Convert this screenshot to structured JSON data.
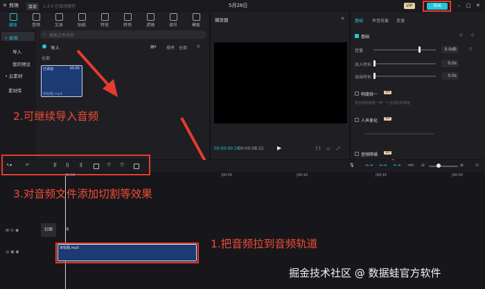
{
  "titlebar": {
    "app_name": "剪映",
    "menu": "菜单",
    "version_hint": "1.3.0  已自动保存",
    "project_date": "5月28日",
    "vip_badge": "VIP",
    "export_label": "导出"
  },
  "toolbar": {
    "tabs": [
      "媒体",
      "音频",
      "文本",
      "贴纸",
      "特效",
      "转场",
      "滤镜",
      "调节",
      "模板"
    ]
  },
  "sidebar": {
    "items": [
      "• 本地",
      "导入",
      "我的预设",
      "• 云素材",
      "素材库"
    ]
  },
  "media": {
    "search_placeholder": "搜索文件名称",
    "import_label": "导入",
    "sort_label": "排序",
    "all_label": "全部",
    "section_label": "全部",
    "clip_added": "已添加",
    "clip_duration": "00:05",
    "clip_name": "未标题.mp3"
  },
  "player": {
    "title": "播放器",
    "current_time": "00:00:00:16",
    "total_time": "00:00:08:22"
  },
  "inspector": {
    "tabs": [
      "基础",
      "声音效果",
      "变速"
    ],
    "section_basic": "基础",
    "volume_label": "音量",
    "volume_value": "0.0dB",
    "fade_in_label": "淡入时长",
    "fade_in_value": "0.0s",
    "fade_out_label": "淡出时长",
    "fade_out_value": "0.0s",
    "loudness_label": "响度统一",
    "loudness_desc": "将音频响度统一到一个合适的标准值",
    "voice_label": "人声美化",
    "denoise_label": "音频降噪",
    "vip": "VIP"
  },
  "timeline": {
    "ticks": [
      "00:00",
      "|00:05",
      "|00:10",
      "|00:15",
      "|00:20"
    ],
    "cover_label": "封面",
    "audio_clip_name": "未标题.mp3"
  },
  "annotations": {
    "step1": "1.把音频拉到音频轨道",
    "step2": "2.可继续导入音频",
    "step3": "3.对音频文件添加切割等效果"
  },
  "watermark": "掘金技术社区 @ 数据蛙官方软件",
  "colors": {
    "annotation_red": "#e53b2f",
    "accent_cyan": "#22c5d9",
    "audio_clip": "#1c3a73"
  }
}
